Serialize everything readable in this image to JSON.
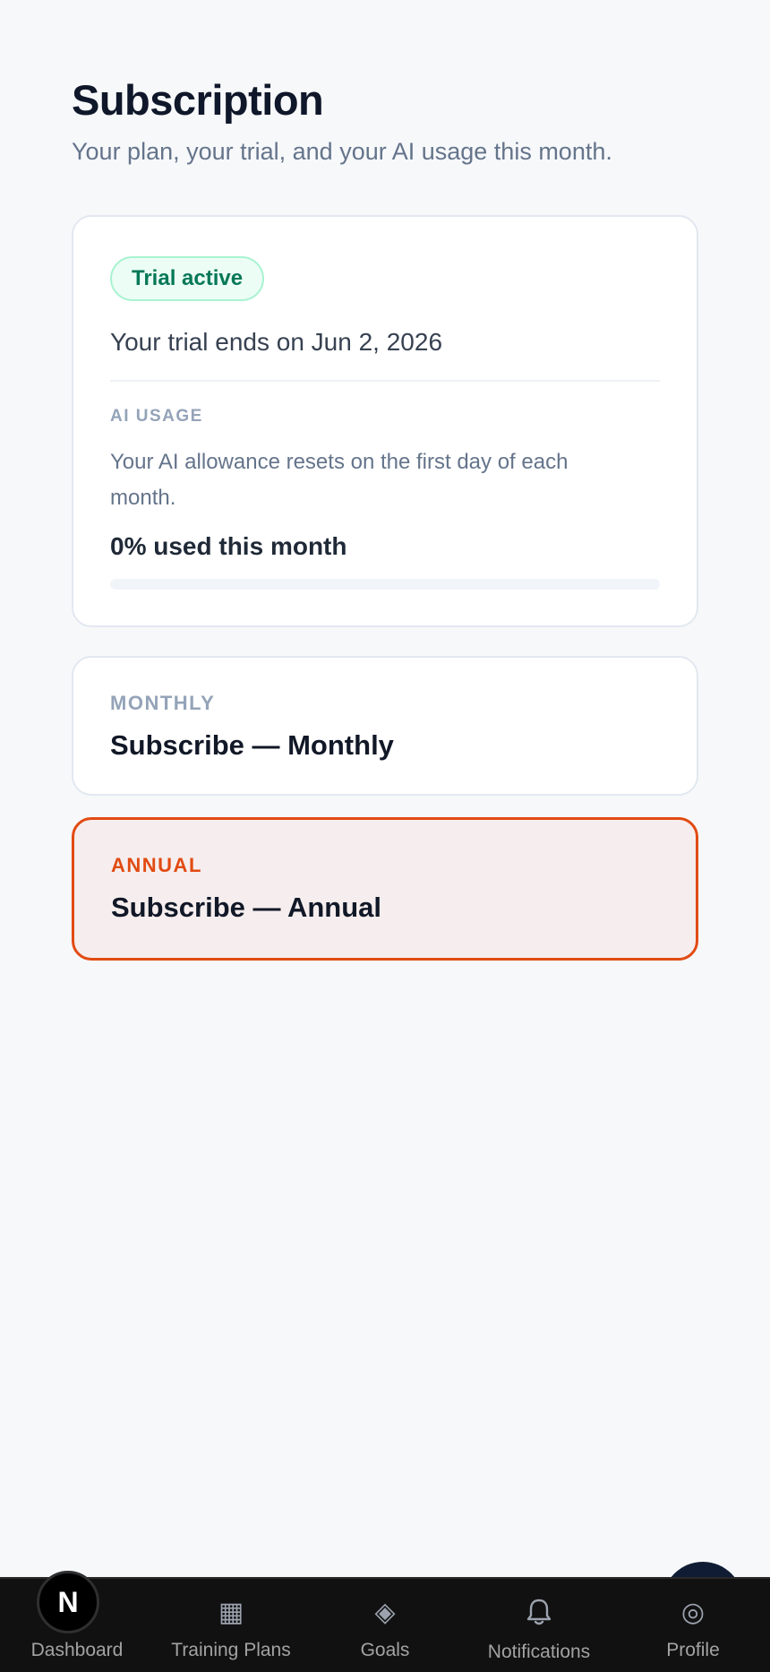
{
  "page": {
    "title": "Subscription",
    "subtitle": "Your plan, your trial, and your AI usage this month."
  },
  "trial": {
    "badge": "Trial active",
    "ends_text": "Your trial ends on Jun 2, 2026"
  },
  "ai_usage": {
    "label": "AI USAGE",
    "description": "Your AI allowance resets on the first day of each month.",
    "stat": "0% used this month",
    "percent_used": 0
  },
  "plans": [
    {
      "label": "MONTHLY",
      "title": "Subscribe — Monthly"
    },
    {
      "label": "ANNUAL",
      "title": "Subscribe — Annual"
    }
  ],
  "nav": {
    "logo_letter": "N",
    "items": [
      {
        "label": "Dashboard",
        "icon": ""
      },
      {
        "label": "Training Plans",
        "icon": "▦"
      },
      {
        "label": "Goals",
        "icon": "◈"
      },
      {
        "label": "Notifications",
        "icon": "bell-icon"
      },
      {
        "label": "Profile",
        "icon": "◎"
      }
    ]
  },
  "colors": {
    "accent": "#e14b12",
    "badge_green": "#047857",
    "nav_bg": "#111111"
  }
}
